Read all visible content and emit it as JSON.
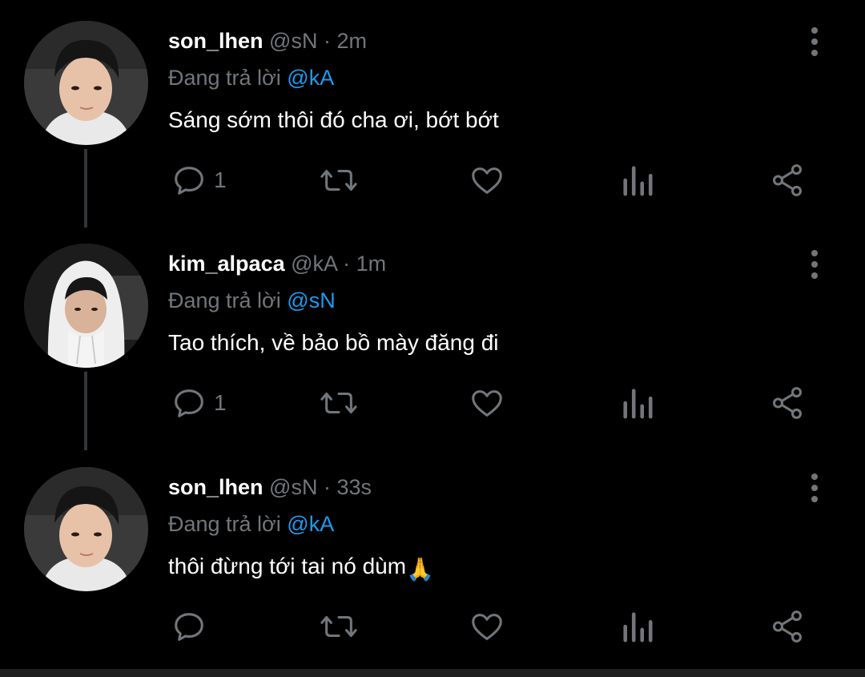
{
  "reply_prefix": "Đang trả lời",
  "tweets": [
    {
      "display_name": "son_lhen",
      "handle": "@sN",
      "separator": "·",
      "time": "2m",
      "reply_to": "@kA",
      "text": "Sáng sớm thôi đó cha ơi, bớt bớt",
      "reply_count": "1",
      "avatar": "person-photo"
    },
    {
      "display_name": "kim_alpaca",
      "handle": "@kA",
      "separator": "·",
      "time": "1m",
      "reply_to": "@sN",
      "text": "Tao thích, về bảo bồ mày đăng đi",
      "reply_count": "1",
      "avatar": "person-hoodie-photo"
    },
    {
      "display_name": "son_lhen",
      "handle": "@sN",
      "separator": "·",
      "time": "33s",
      "reply_to": "@kA",
      "text": "thôi đừng tới tai nó dùm",
      "emoji": "🙏",
      "reply_count": "",
      "avatar": "person-photo"
    }
  ],
  "colors": {
    "background": "#000000",
    "primary_text": "#ffffff",
    "secondary_text": "#71767b",
    "accent": "#1d9bf0",
    "thread_line": "#333639"
  }
}
